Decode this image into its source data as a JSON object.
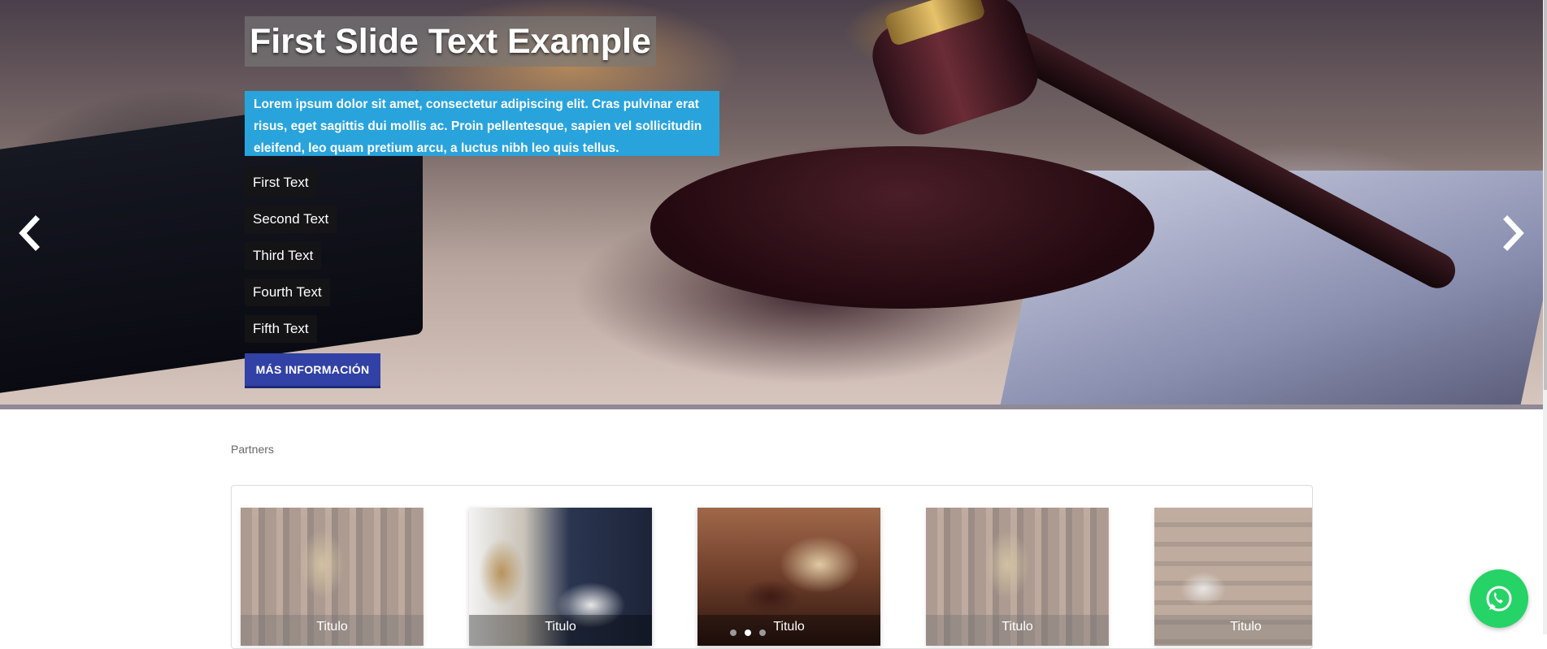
{
  "hero": {
    "title": "First Slide Text Example",
    "description": "Lorem ipsum dolor sit amet, consectetur adipiscing elit. Cras pulvinar erat risus, eget sagittis dui mollis ac. Proin pellentesque, sapien vel sollicitudin eleifend, leo quam pretium arcu, a luctus nibh leo quis tellus.",
    "tags": [
      "First Text",
      "Second Text",
      "Third Text",
      "Fourth Text",
      "Fifth Text"
    ],
    "cta_label": "MÁS INFORMACIÓN",
    "prev_icon": "chevron-left-icon",
    "next_icon": "chevron-right-icon"
  },
  "partners": {
    "label": "Partners",
    "cards": [
      {
        "caption": "Titulo",
        "image": "library-scales-photo"
      },
      {
        "caption": "Titulo",
        "image": "lawyer-signing-photo"
      },
      {
        "caption": "Titulo",
        "image": "gavel-book-photo"
      },
      {
        "caption": "Titulo",
        "image": "library-scales-photo"
      },
      {
        "caption": "Titulo",
        "image": "library-books-photo"
      }
    ],
    "active_dot": 2,
    "dot_count": 3
  },
  "floating": {
    "whatsapp_icon": "whatsapp-icon"
  },
  "colors": {
    "accent_blue": "#29a3dc",
    "button_blue": "#3141a5",
    "whatsapp_green": "#25d366"
  }
}
